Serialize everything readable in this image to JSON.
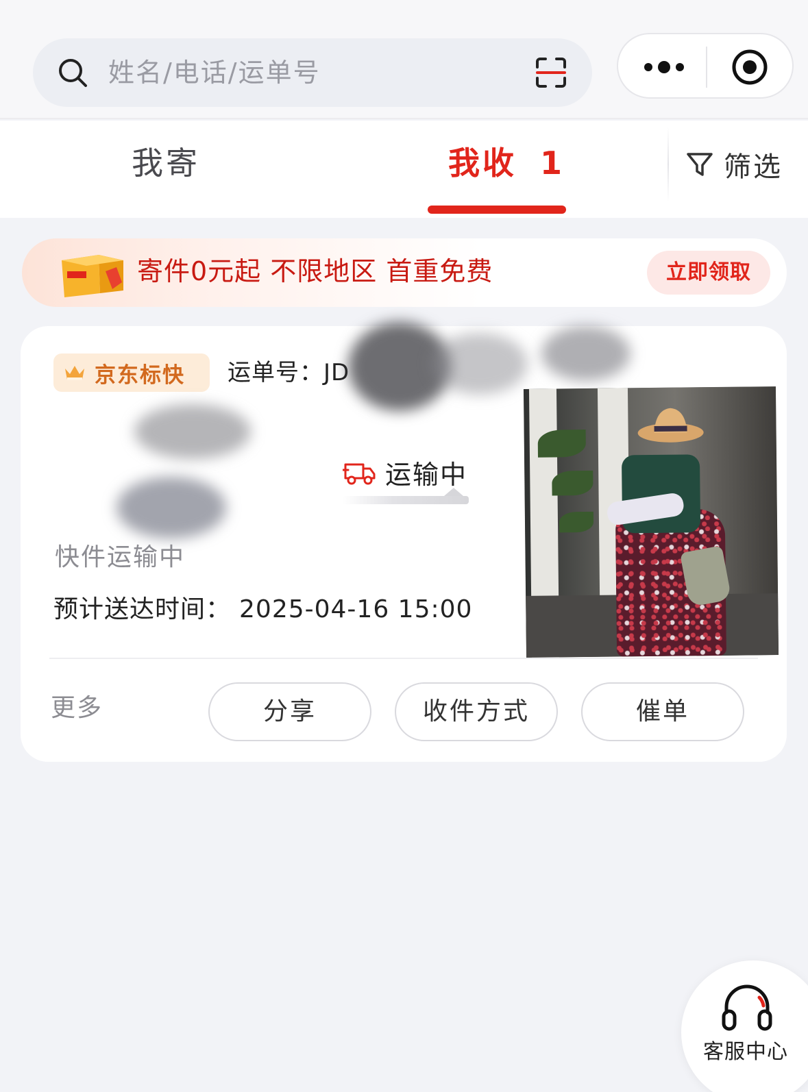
{
  "search": {
    "placeholder": "姓名/电话/运单号"
  },
  "tabs": {
    "send": "我寄",
    "receive": "我收",
    "receive_count": "1",
    "filter": "筛选"
  },
  "promo": {
    "text": "寄件0元起 不限地区 首重免费",
    "cta": "立即领取",
    "accent": "#e1251b"
  },
  "shipment": {
    "service_badge": "京东标快",
    "waybill_label": "运单号：",
    "waybill_visible": "JD",
    "status": "运输中",
    "note": "快件运输中",
    "eta_label": "预计送达时间：",
    "eta_value": "2025-04-16 15:00",
    "more": "更多",
    "actions": [
      "分享",
      "收件方式",
      "催单"
    ]
  },
  "customer_service": {
    "label": "客服中心"
  },
  "icons": {
    "search": "search-icon",
    "scan": "scan-icon",
    "more": "more-dots-icon",
    "record": "record-icon",
    "filter": "filter-icon",
    "crown": "crown-icon",
    "truck": "truck-icon",
    "headset": "headset-icon"
  }
}
